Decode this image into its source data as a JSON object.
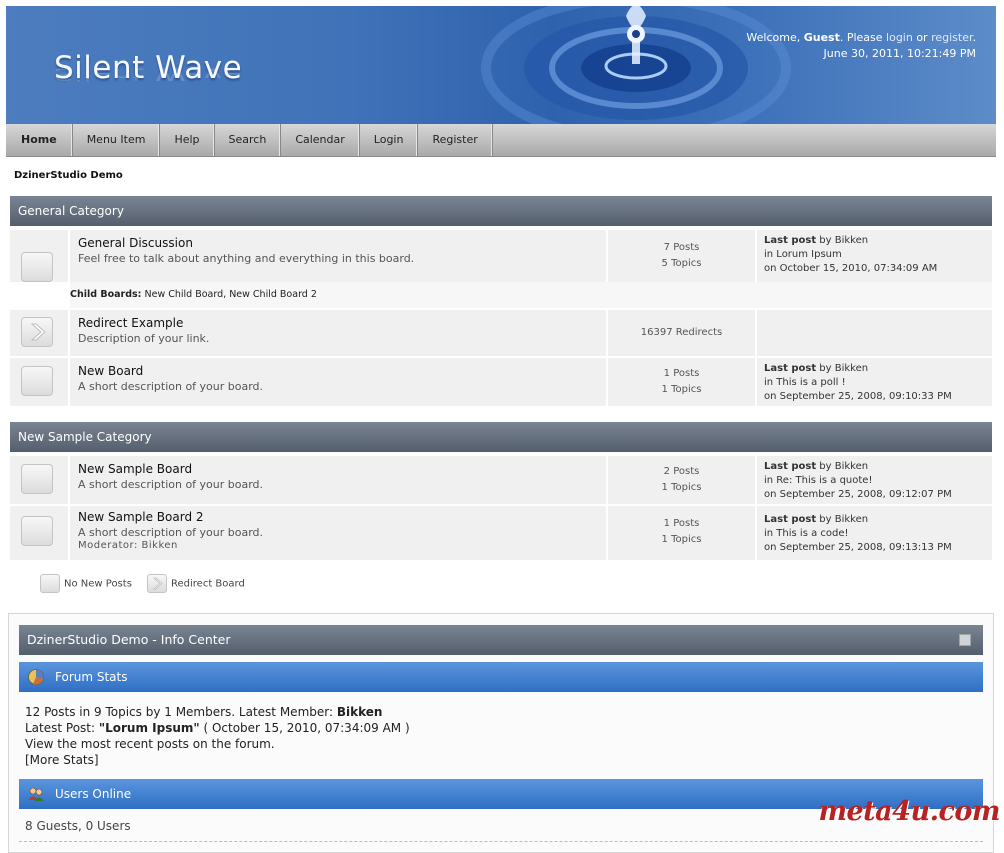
{
  "header": {
    "logo": "Silent Wave",
    "welcome_prefix": "Welcome, ",
    "user": "Guest",
    "please": ". Please ",
    "login_link": "login",
    "or": " or ",
    "register_link": "register",
    "period": ".",
    "datetime": "June 30, 2011, 10:21:49 PM"
  },
  "nav": {
    "items": [
      "Home",
      "Menu Item",
      "Help",
      "Search",
      "Calendar",
      "Login",
      "Register"
    ]
  },
  "breadcrumb": "DzinerStudio Demo",
  "categories": [
    {
      "name": "General Category",
      "boards": [
        {
          "name": "General Discussion",
          "desc": "Feel free to talk about anything and everything in this board.",
          "stat1": "7 Posts",
          "stat2": "5 Topics",
          "last_label": "Last post",
          "by": " by ",
          "author": "Bikken",
          "in": "in ",
          "topic": "Lorum Ipsum",
          "on": "on October 15, 2010, 07:34:09 AM"
        },
        {
          "name": "Redirect Example",
          "desc": "Description of your link.",
          "stat1": "16397 Redirects"
        },
        {
          "name": "New Board",
          "desc": "A short description of your board.",
          "stat1": "1 Posts",
          "stat2": "1 Topics",
          "last_label": "Last post",
          "by": " by ",
          "author": "Bikken",
          "in": "in ",
          "topic": "This is a poll !",
          "on": "on September 25, 2008, 09:10:33 PM"
        }
      ],
      "child_label": "Child Boards:",
      "child_boards": " New Child Board, New Child Board 2"
    },
    {
      "name": "New Sample Category",
      "boards": [
        {
          "name": "New Sample Board",
          "desc": "A short description of your board.",
          "stat1": "2 Posts",
          "stat2": "1 Topics",
          "last_label": "Last post",
          "by": " by ",
          "author": "Bikken",
          "in": "in ",
          "topic": "Re: This is a quote!",
          "on": "on September 25, 2008, 09:12:07 PM"
        },
        {
          "name": "New Sample Board 2",
          "desc": "A short description of your board.",
          "moderator": "Moderator: Bikken",
          "stat1": "1 Posts",
          "stat2": "1 Topics",
          "last_label": "Last post",
          "by": " by ",
          "author": "Bikken",
          "in": "in ",
          "topic": "This is a code!",
          "on": "on September 25, 2008, 09:13:13 PM"
        }
      ]
    }
  ],
  "legend": {
    "no_new": "No New Posts",
    "redirect": "Redirect Board"
  },
  "info_center": {
    "title": "DzinerStudio Demo - Info Center",
    "forum_stats_title": "Forum Stats",
    "stats_line1": "12 Posts in 9 Topics by 1 Members. Latest Member: ",
    "latest_member": "Bikken",
    "latest_post_label": "Latest Post: ",
    "latest_post": "\"Lorum Ipsum\"",
    "latest_post_date": " ( October 15, 2010, 07:34:09 AM )",
    "recent_line": "View the most recent posts on the forum.",
    "more_stats": "[More Stats]",
    "users_online_title": "Users Online",
    "online_count": "8 Guests, 0 Users"
  },
  "watermark": "meta4u.com",
  "colors": {
    "header_blue": "#3f72b8",
    "category_gray": "#5f6977",
    "subheader_blue": "#3f7fd0",
    "watermark_red": "#b82222"
  }
}
